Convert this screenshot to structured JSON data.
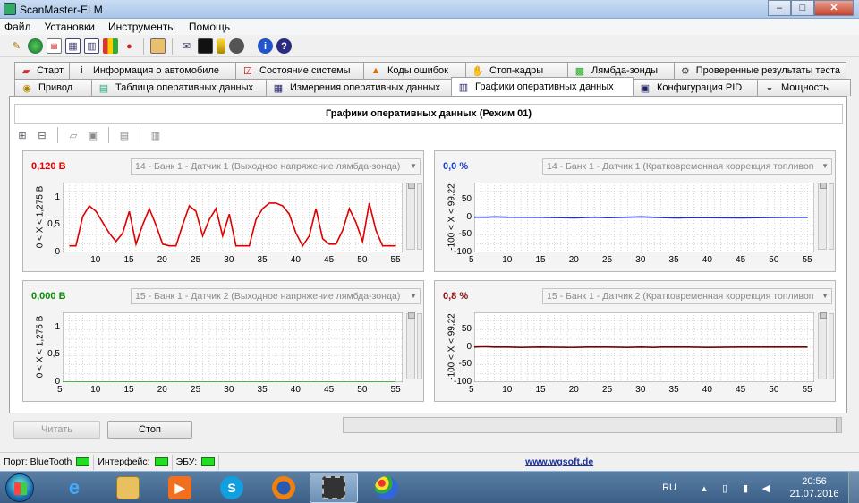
{
  "window": {
    "title": "ScanMaster-ELM",
    "buttons": {
      "minimize": "–",
      "maximize": "□",
      "close": "✕"
    }
  },
  "menu": [
    "Файл",
    "Установки",
    "Инструменты",
    "Помощь"
  ],
  "toolbar_icons": [
    "connect-icon",
    "globe-icon",
    "report-icon",
    "grid-icon",
    "chart-icon",
    "colorbars-icon",
    "trafficlight-icon",
    "clipboard-icon",
    "chat-icon",
    "terminal-icon",
    "battery-icon",
    "stop-icon",
    "info-icon",
    "help-icon"
  ],
  "tabs_row1": [
    {
      "label": "Старт",
      "icon": "car-icon"
    },
    {
      "label": "Информация о автомобиле",
      "icon": "info-icon"
    },
    {
      "label": "Состояние системы",
      "icon": "checklist-icon"
    },
    {
      "label": "Коды ошибок",
      "icon": "warning-icon"
    },
    {
      "label": "Стоп-кадры",
      "icon": "freeze-icon"
    },
    {
      "label": "Лямбда-зонды",
      "icon": "sensor-icon"
    },
    {
      "label": "Проверенные результаты теста",
      "icon": "gear-icon"
    }
  ],
  "tabs_row2": [
    {
      "label": "Привод",
      "icon": "drive-icon"
    },
    {
      "label": "Таблица оперативных данных",
      "icon": "table-icon"
    },
    {
      "label": "Измерения оперативных данных",
      "icon": "gauge-icon"
    },
    {
      "label": "Графики оперативных данных",
      "icon": "graph-icon",
      "active": true
    },
    {
      "label": "Конфигурация PID",
      "icon": "config-icon"
    },
    {
      "label": "Мощность",
      "icon": "power-icon"
    }
  ],
  "graphs_title": "Графики оперативных данных (Режим 01)",
  "graphs": [
    {
      "value": "0,120 В",
      "value_color": "#e00000",
      "pid": "14 - Банк 1 - Датчик 1 (Выходное напряжение лямбда-зонда)",
      "ylabel": "0  < X <  1,275  В",
      "line_color": "#dd0000",
      "chart_data": {
        "type": "line",
        "x": [
          6,
          7,
          8,
          9,
          10,
          11,
          12,
          13,
          14,
          15,
          16,
          17,
          18,
          19,
          20,
          21,
          22,
          23,
          24,
          25,
          26,
          27,
          28,
          29,
          30,
          31,
          32,
          33,
          34,
          35,
          36,
          37,
          38,
          39,
          40,
          41,
          42,
          43,
          44,
          45,
          46,
          47,
          48,
          49,
          50,
          51,
          52,
          53,
          54,
          55
        ],
        "values": [
          0.12,
          0.12,
          0.65,
          0.85,
          0.75,
          0.55,
          0.35,
          0.2,
          0.35,
          0.75,
          0.15,
          0.5,
          0.8,
          0.5,
          0.15,
          0.12,
          0.12,
          0.5,
          0.85,
          0.75,
          0.3,
          0.6,
          0.8,
          0.3,
          0.7,
          0.12,
          0.12,
          0.12,
          0.6,
          0.8,
          0.9,
          0.9,
          0.85,
          0.7,
          0.35,
          0.12,
          0.3,
          0.8,
          0.25,
          0.15,
          0.15,
          0.4,
          0.8,
          0.55,
          0.2,
          0.9,
          0.4,
          0.12,
          0.12,
          0.12
        ],
        "xlim": [
          5,
          56
        ],
        "ylim": [
          0,
          1.275
        ],
        "xticks": [
          "10",
          "15",
          "20",
          "25",
          "30",
          "35",
          "40",
          "45",
          "50",
          "55"
        ],
        "yticks": [
          "0",
          "0,5",
          "1"
        ]
      }
    },
    {
      "value": "0,0 %",
      "value_color": "#1a3fcc",
      "pid": "14 - Банк 1 - Датчик 1 (Кратковременная коррекция топливоп",
      "ylabel": "-100  < X <  99,22",
      "line_color": "#1f2fbf",
      "chart_data": {
        "type": "line",
        "x": [
          5,
          7,
          8,
          10,
          15,
          20,
          22,
          23,
          25,
          28,
          30,
          32,
          35,
          36,
          38,
          40,
          45,
          50,
          55
        ],
        "values": [
          0.5,
          0.5,
          1.5,
          0.5,
          0,
          -1.5,
          -0.5,
          0.5,
          -1,
          0.5,
          1.5,
          0,
          -1.5,
          -1.5,
          -1,
          -1,
          -1.5,
          -0.5,
          0
        ],
        "xlim": [
          5,
          56
        ],
        "ylim": [
          -100,
          99.22
        ],
        "xticks": [
          "5",
          "10",
          "15",
          "20",
          "25",
          "30",
          "35",
          "40",
          "45",
          "50",
          "55"
        ],
        "yticks": [
          "-100",
          "-50",
          "0",
          "50"
        ]
      }
    },
    {
      "value": "0,000 В",
      "value_color": "#0a8a0a",
      "pid": "15 - Банк 1 - Датчик 2 (Выходное напряжение лямбда-зонда)",
      "ylabel": "0  < X <  1,275  В",
      "line_color": "#0a9a0a",
      "chart_data": {
        "type": "line",
        "x": [
          5,
          55
        ],
        "values": [
          0,
          0
        ],
        "xlim": [
          5,
          56
        ],
        "ylim": [
          0,
          1.275
        ],
        "xticks": [
          "5",
          "10",
          "15",
          "20",
          "25",
          "30",
          "35",
          "40",
          "45",
          "50",
          "55"
        ],
        "yticks": [
          "0",
          "0,5",
          "1"
        ]
      }
    },
    {
      "value": "0,8 %",
      "value_color": "#8b1010",
      "pid": "15 - Банк 1 - Датчик 2 (Кратковременная коррекция топливоп",
      "ylabel": "-100  < X <  99,22",
      "line_color": "#7a0000",
      "chart_data": {
        "type": "line",
        "x": [
          5,
          6,
          7,
          8,
          10,
          12,
          15,
          20,
          22,
          25,
          28,
          30,
          32,
          33,
          35,
          37,
          40,
          45,
          50,
          55
        ],
        "values": [
          0,
          1,
          1,
          0,
          0,
          -1,
          0,
          -1,
          0,
          0,
          -1,
          0,
          -1,
          0,
          0,
          0,
          -1,
          0,
          0,
          0
        ],
        "xlim": [
          5,
          56
        ],
        "ylim": [
          -100,
          99.22
        ],
        "xticks": [
          "5",
          "10",
          "15",
          "20",
          "25",
          "30",
          "35",
          "40",
          "45",
          "50",
          "55"
        ],
        "yticks": [
          "-100",
          "-50",
          "0",
          "50"
        ]
      }
    }
  ],
  "buttons": {
    "read": "Читать",
    "stop": "Стоп"
  },
  "status": {
    "port": "Порт: BlueTooth",
    "interface": "Интерфейс:",
    "ecu": "ЭБУ:",
    "url": "www.wgsoft.de"
  },
  "taskbar": {
    "apps": [
      "ie-icon",
      "explorer-icon",
      "mediaplayer-icon",
      "skype-icon",
      "firefox-icon",
      "scanmaster-icon",
      "paint-icon"
    ],
    "lang": "RU",
    "time": "20:56",
    "date": "21.07.2016"
  }
}
